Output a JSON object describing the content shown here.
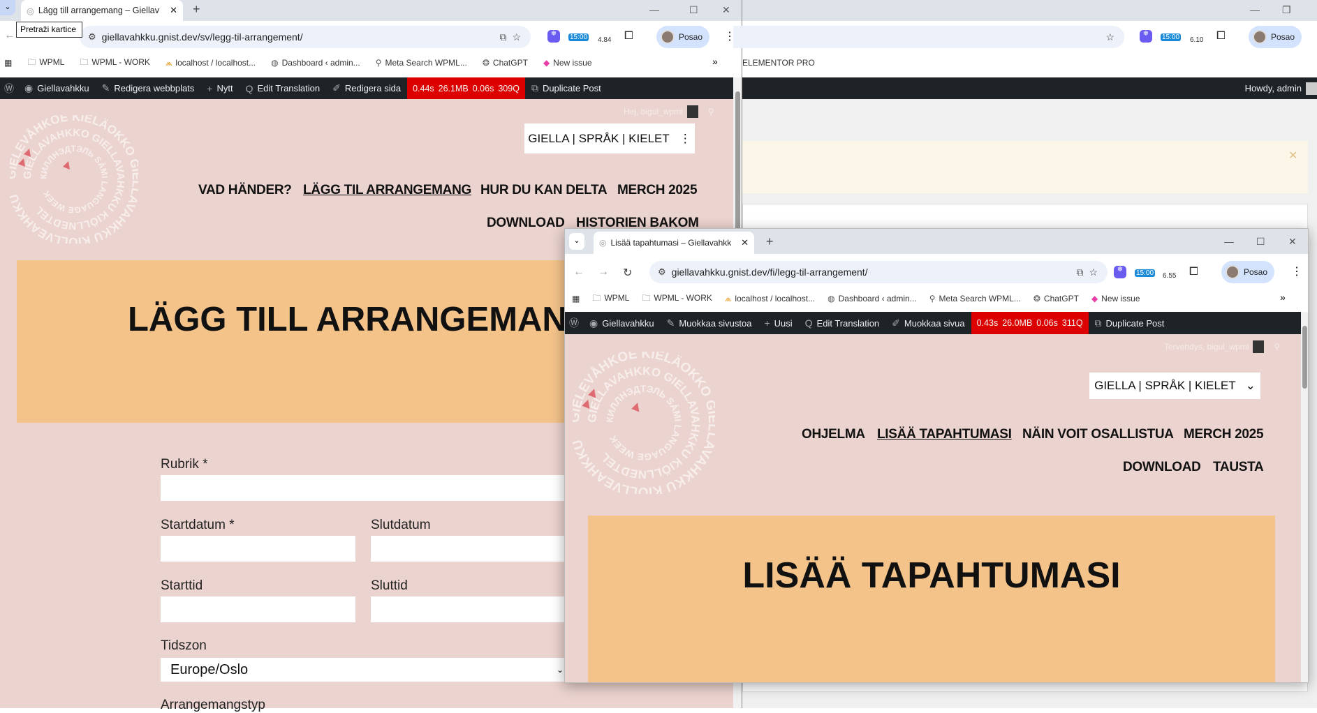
{
  "left_window": {
    "tab_title": "Lägg till arrangemang – Giellav",
    "tooltip": "Pretraži kartice",
    "url": "giellavahkku.gnist.dev/sv/legg-til-arrangement/",
    "ext_badges": [
      "15:00",
      "4.84"
    ],
    "profile": "Posao",
    "bookmarks": [
      "WPML",
      "WPML - WORK",
      "localhost / localhost...",
      "Dashboard ‹ admin...",
      "Meta Search WPML...",
      "ChatGPT",
      "New issue"
    ],
    "adminbar": {
      "site": "Giellavahkku",
      "customize": "Redigera webbplats",
      "new": "Nytt",
      "translate": "Edit Translation",
      "edit": "Redigera sida",
      "perf": [
        "0.44s",
        "26.1MB",
        "0.06s",
        "309Q"
      ],
      "duplicate": "Duplicate Post"
    },
    "greeting": "Hej, bigul_wpml",
    "lang_switcher": "GIELLA | SPRÅK | KIELET",
    "nav": [
      "VAD HÄNDER?",
      "LÄGG TIL ARRANGEMANG",
      "HUR DU KAN DELTA",
      "MERCH 2025",
      "DOWNLOAD",
      "HISTORIEN BAKOM"
    ],
    "heading": "LÄGG TILL ARRANGEMANG",
    "form": {
      "title_label": "Rubrik *",
      "start_date_label": "Startdatum *",
      "end_date_label": "Slutdatum",
      "start_time_label": "Starttid",
      "end_time_label": "Sluttid",
      "timezone_label": "Tidszon",
      "timezone_value": "Europe/Oslo",
      "event_type_label": "Arrangemangstyp"
    }
  },
  "back_window": {
    "ext_badges": [
      "15:00",
      "6.10"
    ],
    "profile": "Posao",
    "bookmark": "ELEMENTOR PRO",
    "howdy": "Howdy, admin"
  },
  "popup_window": {
    "tab_title": "Lisää tapahtumasi – Giellavahkk",
    "url": "giellavahkku.gnist.dev/fi/legg-til-arrangement/",
    "ext_badges": [
      "15:00",
      "6.55"
    ],
    "profile": "Posao",
    "bookmarks": [
      "WPML",
      "WPML - WORK",
      "localhost / localhost...",
      "Dashboard ‹ admin...",
      "Meta Search WPML...",
      "ChatGPT",
      "New issue"
    ],
    "adminbar": {
      "site": "Giellavahkku",
      "customize": "Muokkaa sivustoa",
      "new": "Uusi",
      "translate": "Edit Translation",
      "edit": "Muokkaa sivua",
      "perf": [
        "0.43s",
        "26.0MB",
        "0.06s",
        "311Q"
      ],
      "duplicate": "Duplicate Post"
    },
    "greeting": "Tervehdys, bigul_wpml",
    "lang_switcher": "GIELLA | SPRÅK | KIELET",
    "nav": [
      "OHJELMA",
      "LISÄÄ TAPAHTUMASI",
      "NÄIN VOIT OSALLISTUA",
      "MERCH 2025",
      "DOWNLOAD",
      "TAUSTA"
    ],
    "heading": "LISÄÄ TAPAHTUMASI"
  },
  "logo_text": {
    "outer": "GIELEVÅHKOE KIELÄOKKO GIÉLLAVAHKKU KIÖLLVEAHKKU",
    "middle": "GIELLAVAHKKO GIELLAVAHKKU KIÖLLNEDTEL",
    "inner": "КИЛЛНЭДТЭЛЬ SÁMI LANGUAGE WEEK"
  },
  "colors": {
    "page_bg": "#ebd3cf",
    "banner": "#f4c38a",
    "adminbar": "#1d2327",
    "perf_red": "#dd0000"
  }
}
